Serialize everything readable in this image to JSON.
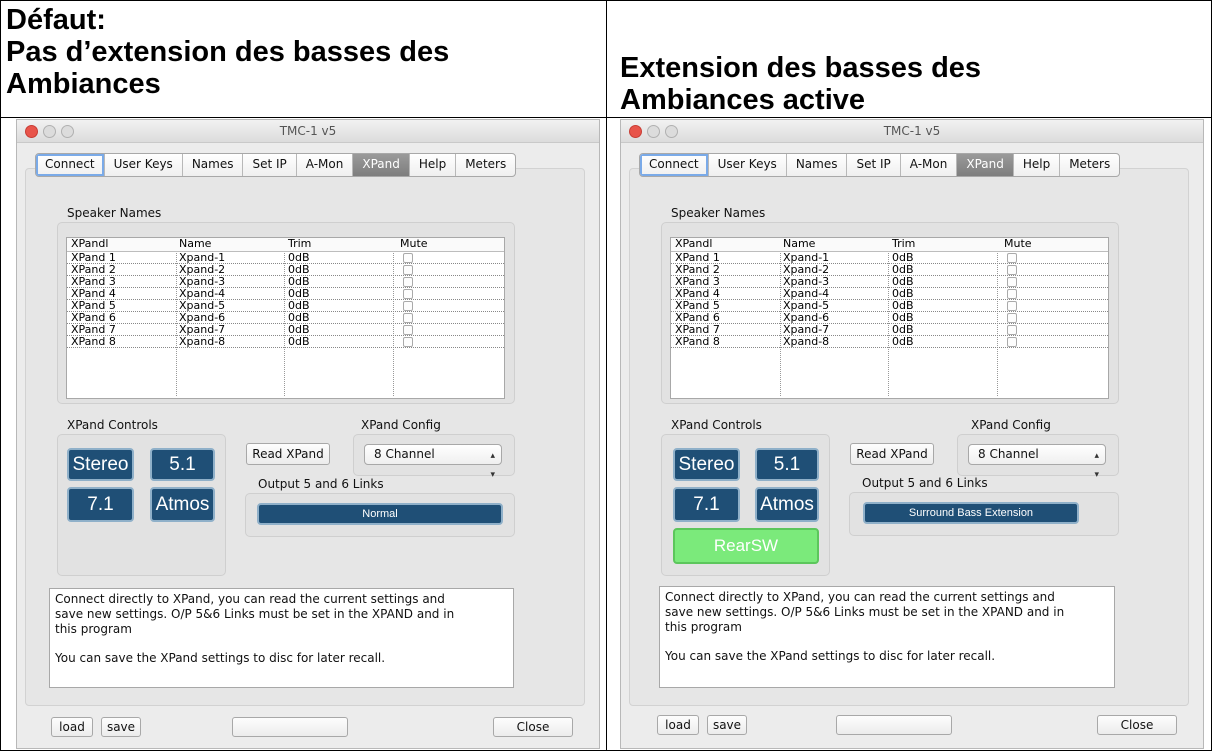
{
  "captions": {
    "left": {
      "line1": "Défaut:",
      "line2": "Pas d’extension des basses des",
      "line3": "Ambiances"
    },
    "right": {
      "line1": "Extension des basses des",
      "line2": "Ambiances active"
    }
  },
  "window": {
    "title": "TMC-1 v5",
    "tabs": [
      "Connect",
      "User Keys",
      "Names",
      "Set IP",
      "A-Mon",
      "XPand",
      "Help",
      "Meters"
    ],
    "active_tab": "XPand",
    "speaker_names_label": "Speaker Names",
    "table": {
      "headers": [
        "XPandl",
        "Name",
        "Trim",
        "Mute"
      ],
      "rows": [
        [
          "XPand 1",
          "Xpand-1",
          "0dB"
        ],
        [
          "XPand 2",
          "Xpand-2",
          "0dB"
        ],
        [
          "XPand 3",
          "Xpand-3",
          "0dB"
        ],
        [
          "XPand 4",
          "Xpand-4",
          "0dB"
        ],
        [
          "XPand 5",
          "Xpand-5",
          "0dB"
        ],
        [
          "XPand 6",
          "Xpand-6",
          "0dB"
        ],
        [
          "XPand 7",
          "Xpand-7",
          "0dB"
        ],
        [
          "XPand 8",
          "Xpand-8",
          "0dB"
        ]
      ]
    },
    "controls_label": "XPand Controls",
    "buttons": {
      "stereo": "Stereo",
      "five_one": "5.1",
      "seven_one": "7.1",
      "atmos": "Atmos",
      "rearsw": "RearSW"
    },
    "read_button": "Read XPand",
    "config_label": "XPand Config",
    "config_value": "8 Channel",
    "links_label": "Output 5 and 6 Links",
    "links_value_left": "Normal",
    "links_value_right": "Surround Bass Extension",
    "info": {
      "line1": "Connect directly to  XPand, you can read the current settings and",
      "line2": "save new settings. O/P 5&6 Links must be set in the XPAND and in",
      "line3": "this program",
      "line4": "You can save the XPand settings to disc for later recall."
    },
    "bottom": {
      "load": "load",
      "save": "save",
      "close": "Close"
    },
    "colors": {
      "blue_button": "#1f4f76",
      "green_button": "#7bea7b",
      "active_tab": "#8a8a8a"
    }
  }
}
